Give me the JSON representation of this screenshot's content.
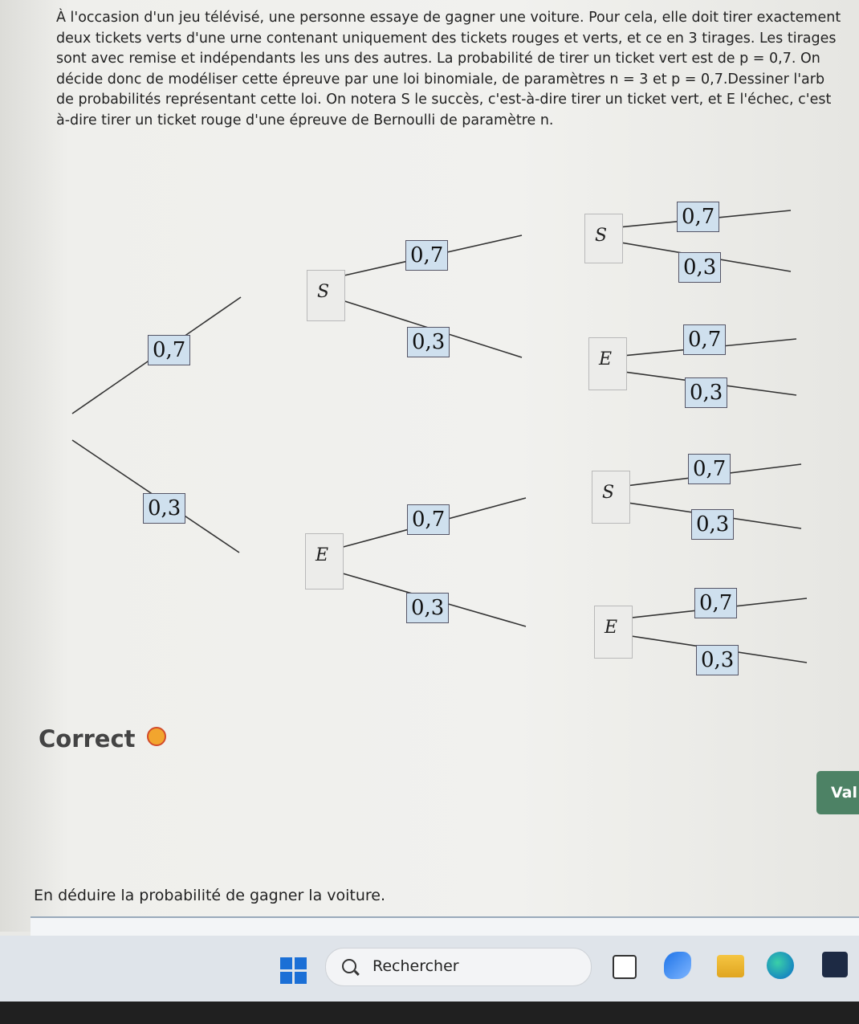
{
  "statement": {
    "lines": [
      "À l'occasion d'un jeu télévisé, une personne essaye de gagner une voiture. Pour cela, elle doit tirer exactement",
      "deux tickets verts d'une urne contenant uniquement des tickets rouges et verts, et ce en 3 tirages. Les tirages",
      "sont avec remise et indépendants les uns des autres. La probabilité de tirer un ticket vert est de p = 0,7. On",
      "décide donc de modéliser cette épreuve par une loi binomiale, de paramètres n = 3 et p = 0,7.Dessiner l'arb",
      "de probabilités représentant cette loi. On notera S le succès, c'est-à-dire tirer un ticket vert, et E l'échec, c'est",
      "à-dire tirer un ticket rouge d'une épreuve de Bernoulli de paramètre n."
    ]
  },
  "tree": {
    "level1": {
      "top": "0,7",
      "bottom": "0,3"
    },
    "level2": {
      "s_node": "S",
      "e_node": "E",
      "s_top": "0,7",
      "s_bottom": "0,3",
      "e_top": "0,7",
      "e_bottom": "0,3"
    },
    "level3": {
      "nodes": [
        "S",
        "E",
        "S",
        "E"
      ],
      "probs": [
        "0,7",
        "0,3",
        "0,7",
        "0,3",
        "0,7",
        "0,3",
        "0,7",
        "0,3"
      ]
    }
  },
  "feedback": {
    "label": "Correct",
    "icon": "sad-face-icon",
    "color": "#444444"
  },
  "validate_button": {
    "label": "Val"
  },
  "question2": {
    "text": "En déduire la probabilité de gagner la voiture."
  },
  "taskbar": {
    "search_placeholder": "Rechercher",
    "icons": [
      "windows-start-icon",
      "search-icon",
      "file-explorer-icon",
      "app-icon",
      "folder-icon",
      "edge-browser-icon",
      "store-icon"
    ]
  },
  "colors": {
    "prob_box": "#cfe0ee",
    "validate": "#4d8265",
    "windows_blue": "#1b6fd6"
  }
}
